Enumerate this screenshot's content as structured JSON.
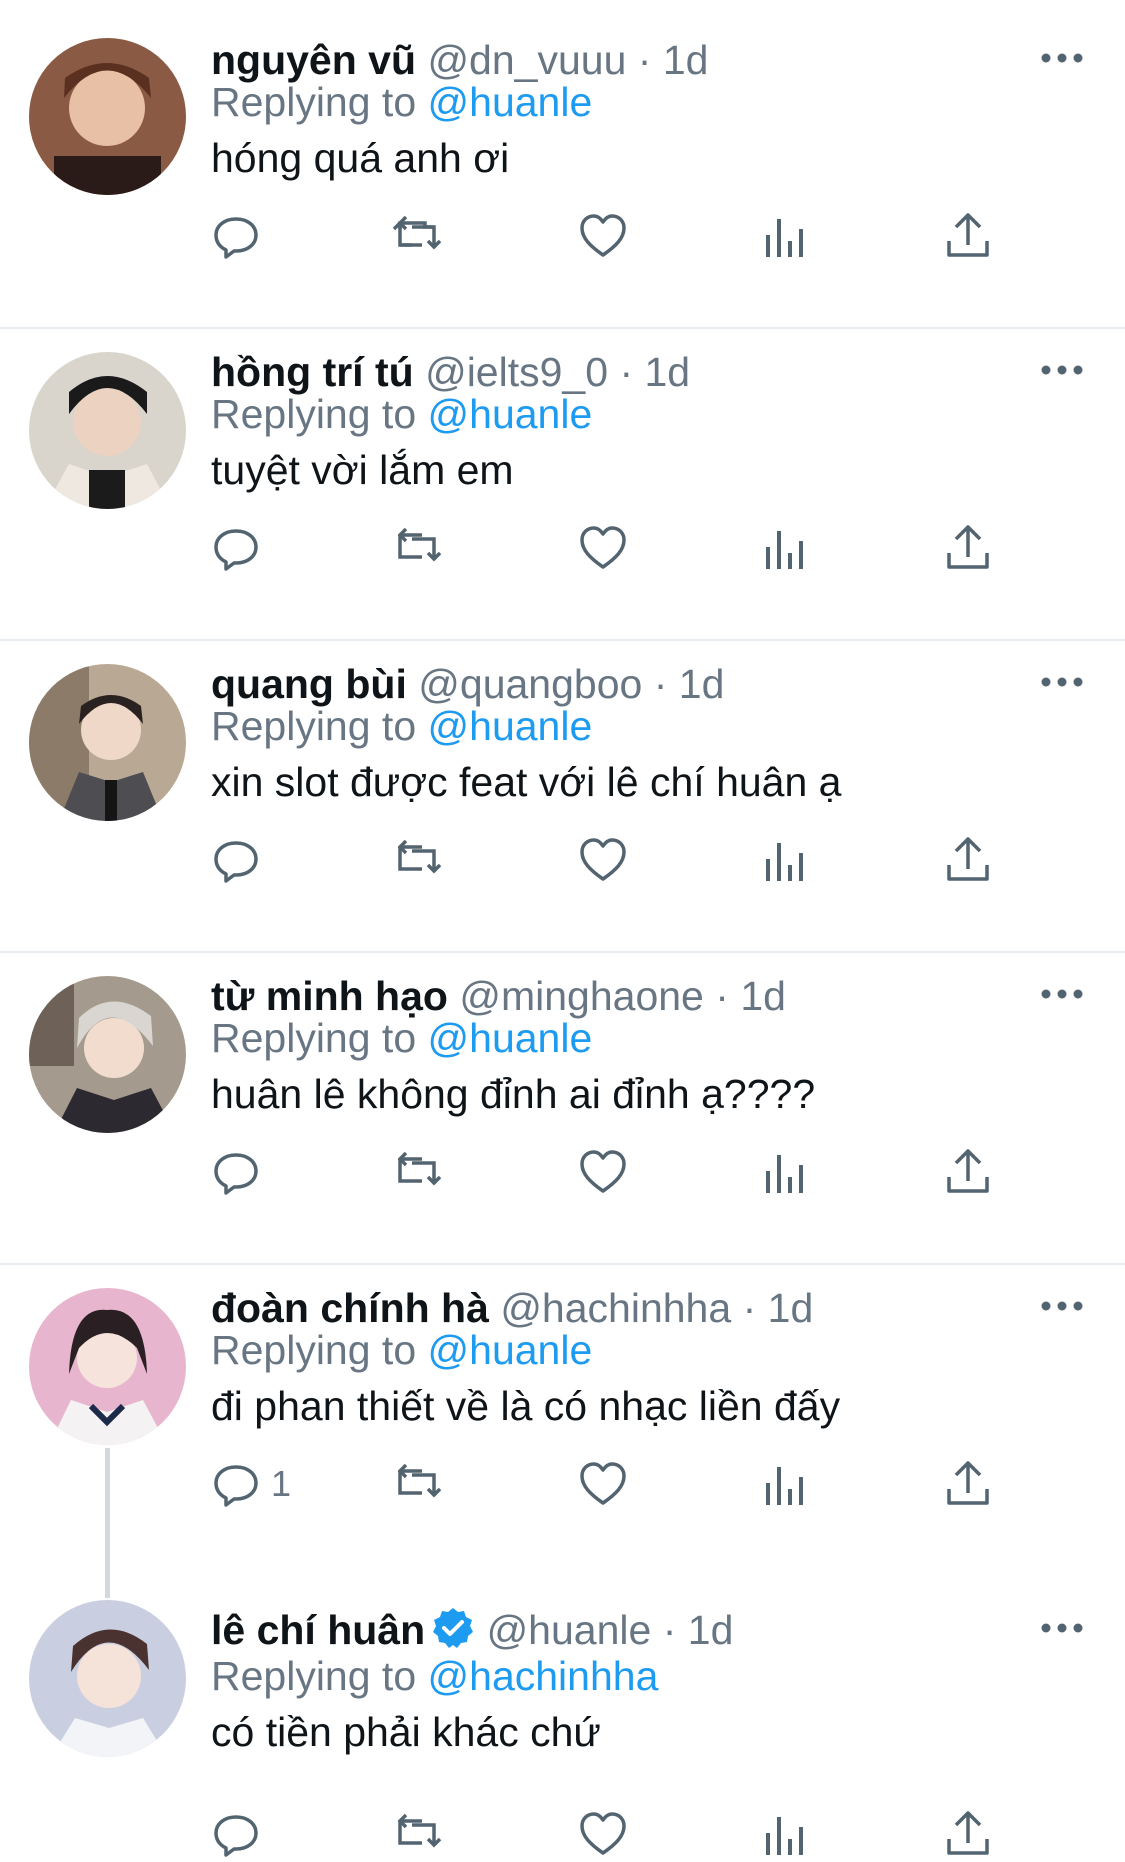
{
  "reply_prefix": "Replying to",
  "tweets": [
    {
      "name": "nguyên vũ",
      "handle": "@dn_vuuu",
      "separator": "·",
      "time": "1d",
      "replying_to": "@huanle",
      "text": "hóng quá anh ơi",
      "reply_count": "",
      "verified": false
    },
    {
      "name": "hồng trí tú",
      "handle": "@ielts9_0",
      "separator": "·",
      "time": "1d",
      "replying_to": "@huanle",
      "text": "tuyệt vời lắm em",
      "reply_count": "",
      "verified": false
    },
    {
      "name": "quang bùi",
      "handle": "@quangboo",
      "separator": "·",
      "time": "1d",
      "replying_to": "@huanle",
      "text": "xin slot được feat với lê chí huân ạ",
      "reply_count": "",
      "verified": false
    },
    {
      "name": "từ minh hạo",
      "handle": "@minghaone",
      "separator": "·",
      "time": "1d",
      "replying_to": "@huanle",
      "text": "huân lê không đỉnh ai đỉnh ạ????",
      "reply_count": "",
      "verified": false
    },
    {
      "name": "đoàn chính hà",
      "handle": "@hachinhha",
      "separator": "·",
      "time": "1d",
      "replying_to": "@huanle",
      "text": "đi phan thiết về là có nhạc liền đấy",
      "reply_count": "1",
      "verified": false
    },
    {
      "name": "lê chí huân",
      "handle": "@huanle",
      "separator": "·",
      "time": "1d",
      "replying_to": "@hachinhha",
      "text": "có tiền phải khác chứ",
      "reply_count": "",
      "verified": true
    }
  ],
  "colors": {
    "accent": "#1d9bf0",
    "secondary_text": "#687684",
    "icon": "#536471",
    "divider": "#e6ecf0"
  },
  "icons": [
    "reply-icon",
    "retweet-icon",
    "like-icon",
    "analytics-icon",
    "share-icon",
    "more-icon",
    "verified-badge-icon"
  ]
}
